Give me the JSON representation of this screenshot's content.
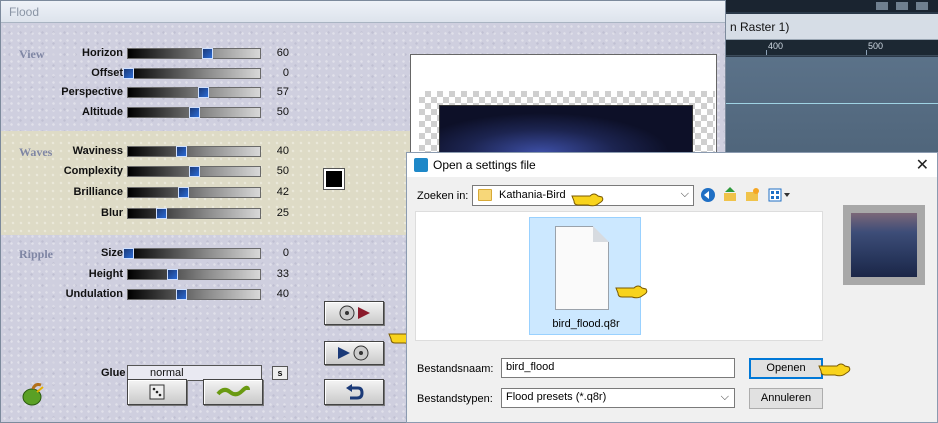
{
  "background_app": {
    "title_fragment": "n Raster 1)",
    "ruler_labels": [
      "400",
      "500"
    ]
  },
  "flood": {
    "title": "Flood",
    "sections": {
      "view": "View",
      "waves": "Waves",
      "ripple": "Ripple"
    },
    "params": {
      "horizon": {
        "label": "Horizon",
        "value": "60",
        "fraction": 0.6
      },
      "offset": {
        "label": "Offset",
        "value": "0",
        "fraction": 0.0
      },
      "perspective": {
        "label": "Perspective",
        "value": "57",
        "fraction": 0.57
      },
      "altitude": {
        "label": "Altitude",
        "value": "50",
        "fraction": 0.5
      },
      "waviness": {
        "label": "Waviness",
        "value": "40",
        "fraction": 0.4
      },
      "complexity": {
        "label": "Complexity",
        "value": "50",
        "fraction": 0.5
      },
      "brilliance": {
        "label": "Brilliance",
        "value": "42",
        "fraction": 0.42
      },
      "blur": {
        "label": "Blur",
        "value": "25",
        "fraction": 0.25
      },
      "size": {
        "label": "Size",
        "value": "0",
        "fraction": 0.0
      },
      "height": {
        "label": "Height",
        "value": "33",
        "fraction": 0.33
      },
      "undulation": {
        "label": "Undulation",
        "value": "40",
        "fraction": 0.4
      }
    },
    "glue": {
      "label": "Glue",
      "value": "normal",
      "s_button": "s"
    },
    "colors": {
      "wave_color": "#000000",
      "accent": "#2b6bd6"
    }
  },
  "open_dialog": {
    "title": "Open a settings file",
    "close_glyph": "✕",
    "look_in_label": "Zoeken in:",
    "look_in_value": "Kathania-Bird",
    "files": [
      {
        "name": "bird_flood.q8r"
      }
    ],
    "filename_label": "Bestandsnaam:",
    "filename_value": "bird_flood",
    "filetype_label": "Bestandstypen:",
    "filetype_value": "Flood presets (*.q8r)",
    "open_button": "Openen",
    "cancel_button": "Annuleren"
  }
}
